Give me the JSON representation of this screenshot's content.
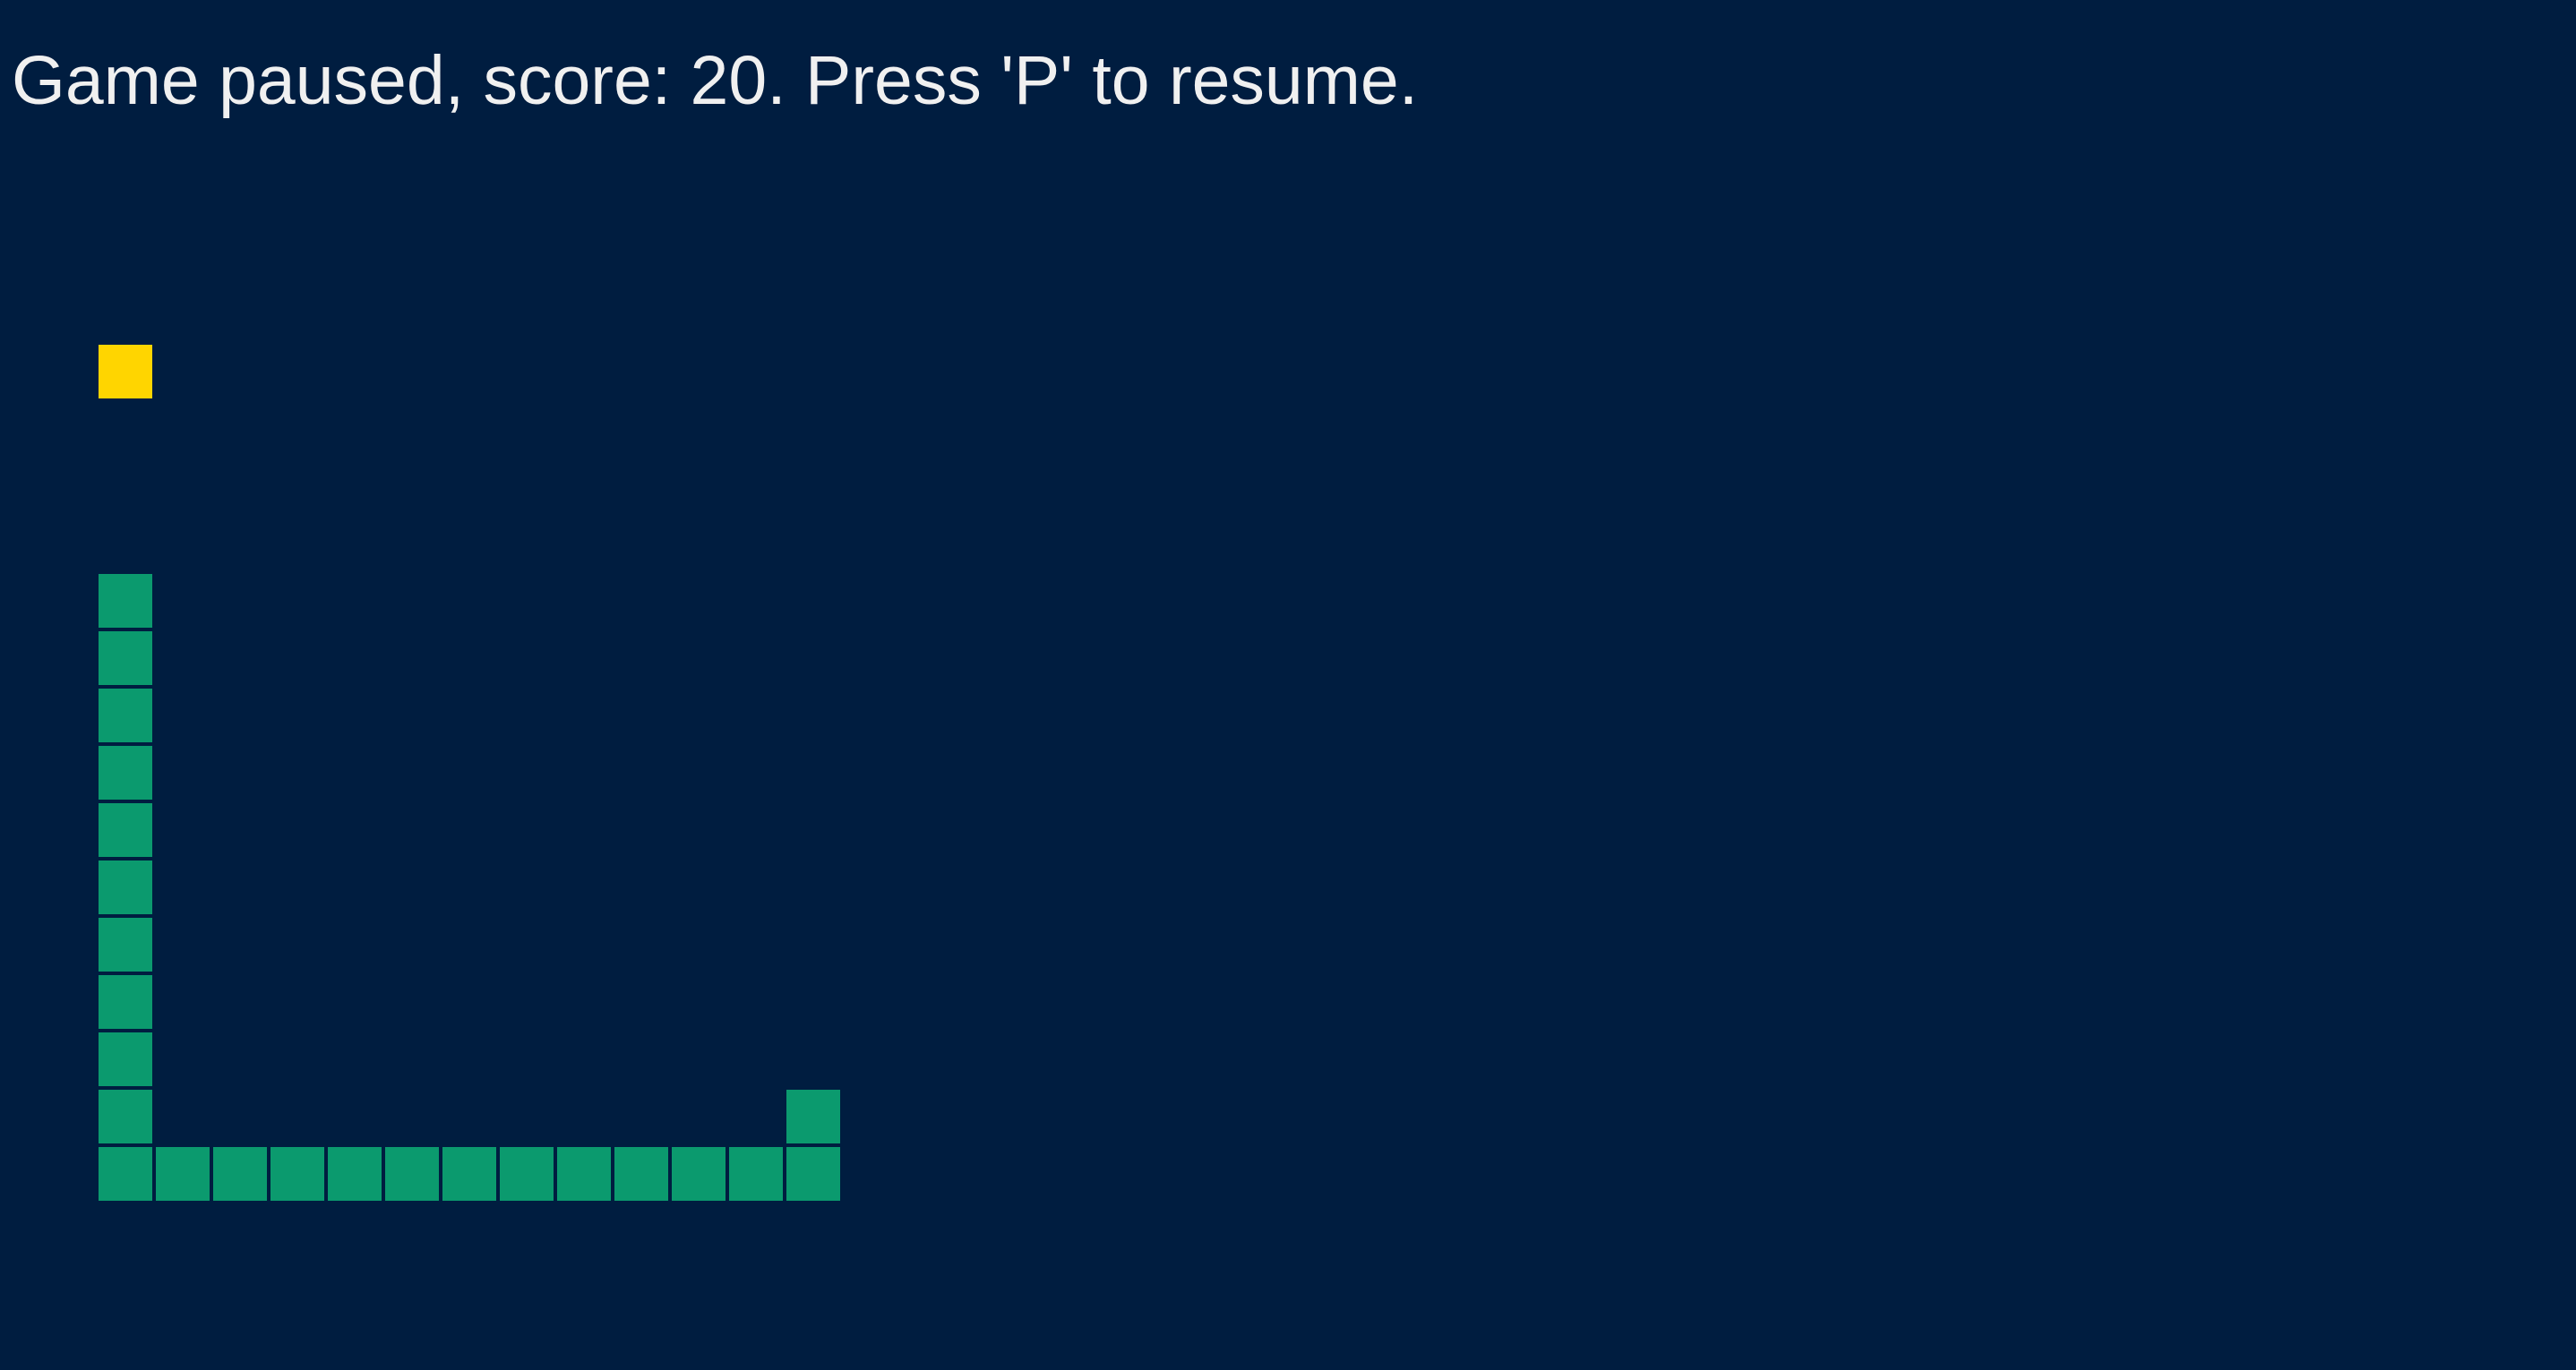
{
  "status": {
    "message": "Game paused, score: 20. Press 'P' to resume."
  },
  "game": {
    "state": "paused",
    "score": 20,
    "pause_key": "P",
    "colors": {
      "background": "#001d40",
      "snake": "#0b9a6e",
      "food": "#ffd500",
      "text": "#f0f0f0"
    },
    "food": {
      "col": 1,
      "row": 5
    },
    "snake": [
      {
        "col": 1,
        "row": 9
      },
      {
        "col": 1,
        "row": 10
      },
      {
        "col": 1,
        "row": 11
      },
      {
        "col": 1,
        "row": 12
      },
      {
        "col": 1,
        "row": 13
      },
      {
        "col": 1,
        "row": 14
      },
      {
        "col": 1,
        "row": 15
      },
      {
        "col": 1,
        "row": 16
      },
      {
        "col": 1,
        "row": 17
      },
      {
        "col": 1,
        "row": 18
      },
      {
        "col": 1,
        "row": 19
      },
      {
        "col": 2,
        "row": 19
      },
      {
        "col": 3,
        "row": 19
      },
      {
        "col": 4,
        "row": 19
      },
      {
        "col": 5,
        "row": 19
      },
      {
        "col": 6,
        "row": 19
      },
      {
        "col": 7,
        "row": 19
      },
      {
        "col": 8,
        "row": 19
      },
      {
        "col": 9,
        "row": 19
      },
      {
        "col": 10,
        "row": 19
      },
      {
        "col": 11,
        "row": 19
      },
      {
        "col": 12,
        "row": 19
      },
      {
        "col": 13,
        "row": 19
      },
      {
        "col": 13,
        "row": 18
      }
    ]
  }
}
